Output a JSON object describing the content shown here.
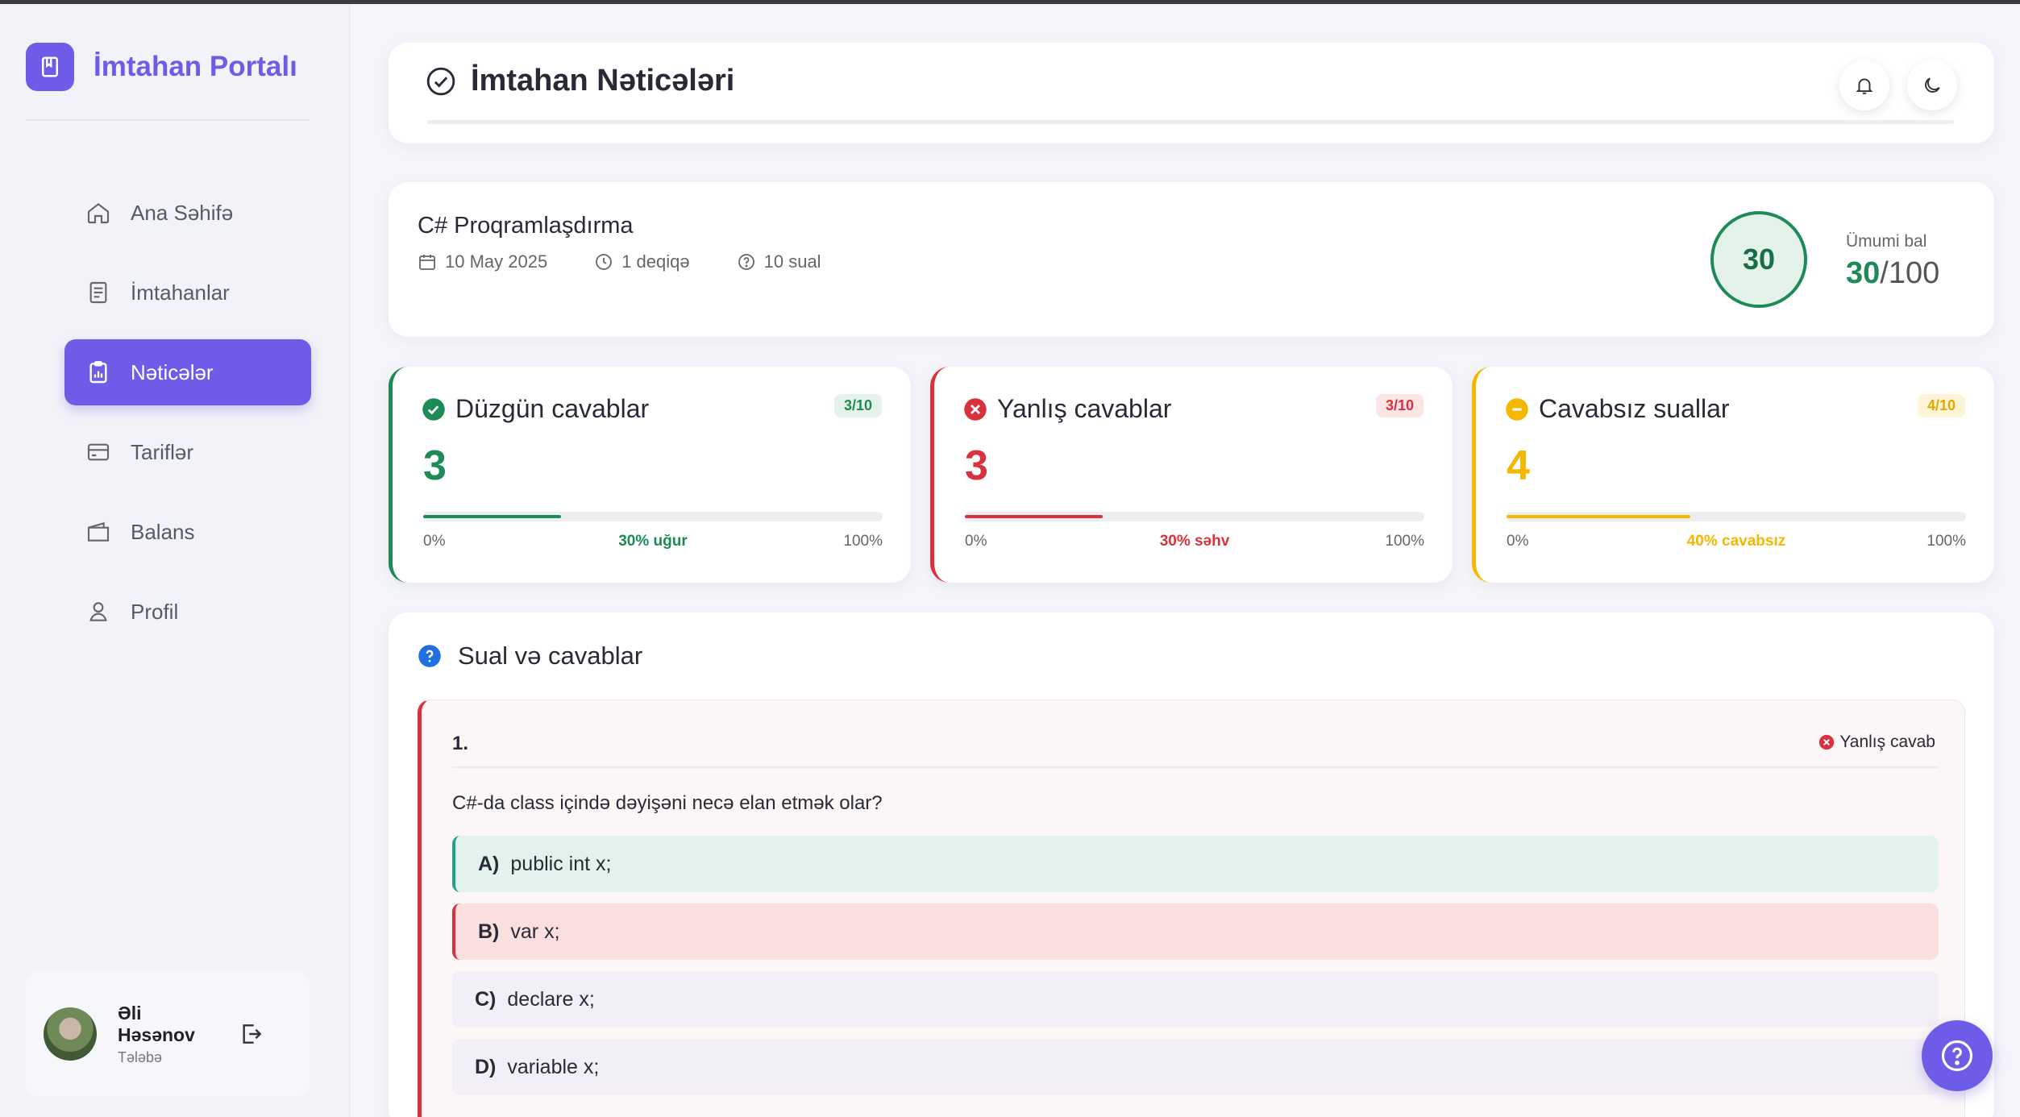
{
  "app": {
    "title": "İmtahan Portalı"
  },
  "sidebar": {
    "items": [
      {
        "label": "Ana Səhifə",
        "icon": "home-icon"
      },
      {
        "label": "İmtahanlar",
        "icon": "document-list-icon"
      },
      {
        "label": "Nəticələr",
        "icon": "clipboard-chart-icon",
        "active": true
      },
      {
        "label": "Tariflər",
        "icon": "credit-card-icon"
      },
      {
        "label": "Balans",
        "icon": "wallet-icon"
      },
      {
        "label": "Profil",
        "icon": "user-icon"
      }
    ],
    "user": {
      "name": "Əli Həsənov",
      "role": "Tələbə"
    }
  },
  "header": {
    "title": "İmtahan Nəticələri"
  },
  "exam": {
    "name": "C# Proqramlaşdırma",
    "date": "10 May 2025",
    "duration": "1 deqiqə",
    "questions": "10 sual",
    "score": "30",
    "score_label": "Ümumi bal",
    "score_total": "/100"
  },
  "stats": {
    "correct": {
      "title": "Düzgün cavablar",
      "badge": "3/10",
      "value": "3",
      "percent": 30,
      "min": "0%",
      "max": "100%",
      "label": "30% uğur"
    },
    "wrong": {
      "title": "Yanlış cavablar",
      "badge": "3/10",
      "value": "3",
      "percent": 30,
      "min": "0%",
      "max": "100%",
      "label": "30% səhv"
    },
    "unanswered": {
      "title": "Cavabsız suallar",
      "badge": "4/10",
      "value": "4",
      "percent": 40,
      "min": "0%",
      "max": "100%",
      "label": "40% cavabsız"
    }
  },
  "qa": {
    "title": "Sual və cavablar",
    "question": {
      "number": "1.",
      "status": "Yanlış cavab",
      "text": "C#-da class içində dəyişəni necə elan etmək olar?",
      "options": [
        {
          "letter": "A)",
          "text": "public int x;",
          "state": "correct"
        },
        {
          "letter": "B)",
          "text": "var x;",
          "state": "wrong"
        },
        {
          "letter": "C)",
          "text": "declare x;",
          "state": "none"
        },
        {
          "letter": "D)",
          "text": "variable x;",
          "state": "none"
        }
      ]
    }
  },
  "colors": {
    "accent": "#6d5ce8",
    "success": "#1e8a55",
    "danger": "#d9323e",
    "warning": "#f5b800"
  }
}
